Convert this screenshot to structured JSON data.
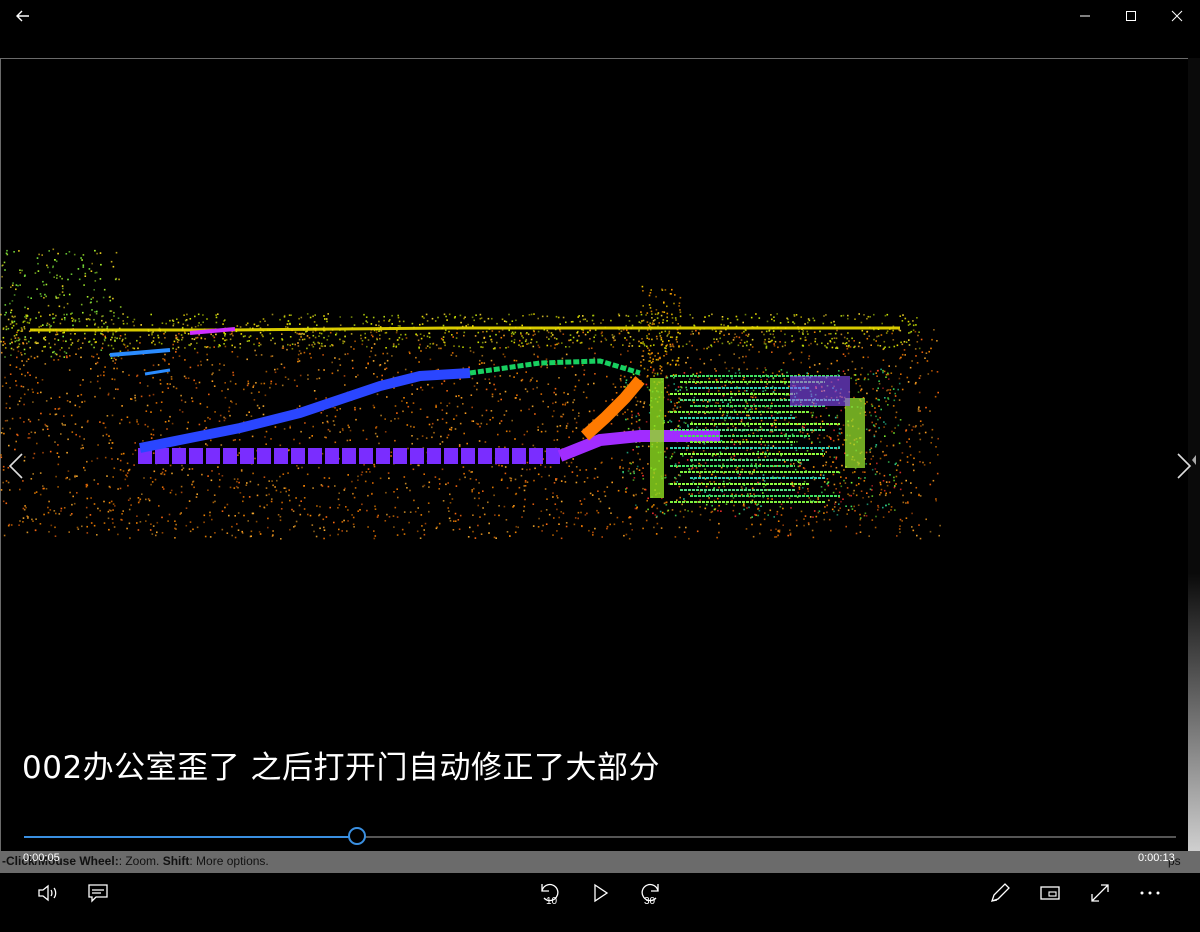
{
  "window": {
    "back_icon": "back-arrow-icon",
    "controls": [
      "minimize-icon",
      "maximize-icon",
      "close-icon"
    ]
  },
  "video": {
    "subtitle": "002办公室歪了 之后打开门自动修正了大部分",
    "overlay_hint_bold_1": "-Click/Mouse Wheel:",
    "overlay_hint_1": ": Zoom. ",
    "overlay_hint_bold_2": "Shift",
    "overlay_hint_2": ": More options.",
    "overlay_hint_right": "ps"
  },
  "playback": {
    "current_time": "0:00:05",
    "total_time": "0:00:13",
    "progress": 0.289
  },
  "controls": {
    "left": [
      "volume-icon",
      "captions-icon"
    ],
    "center": {
      "rewind_label": "10",
      "forward_label": "30"
    },
    "right": [
      "edit-icon",
      "mini-view-icon",
      "fullscreen-icon",
      "more-icon"
    ]
  },
  "colors": {
    "accent": "#3a8fe0",
    "background": "#000000",
    "hint_strip": "#6b6b6b"
  }
}
